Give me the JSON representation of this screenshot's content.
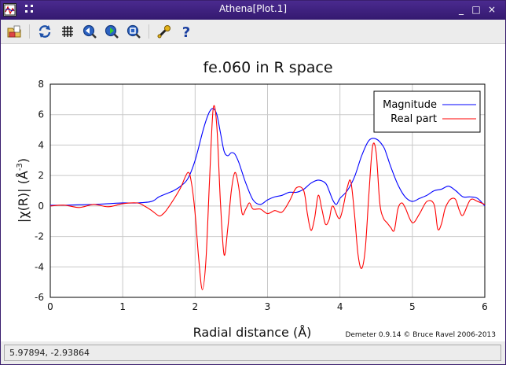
{
  "window": {
    "title": "Athena[Plot.1]",
    "buttons": [
      "_",
      "□",
      "×"
    ]
  },
  "toolbar": {
    "items": [
      {
        "icon": "open-folder-icon"
      },
      {
        "icon": "refresh-icon"
      },
      {
        "icon": "grid-icon"
      },
      {
        "icon": "zoom-back-icon"
      },
      {
        "icon": "zoom-forward-icon"
      },
      {
        "icon": "zoom-icon"
      },
      {
        "icon": "settings-wrench-icon"
      },
      {
        "icon": "help-icon"
      }
    ]
  },
  "status": {
    "text": "5.97894, -2.93864"
  },
  "colors": {
    "magnitude": "#0000ff",
    "real": "#ff0000",
    "titlebar": "#3d2080"
  },
  "chart_data": {
    "type": "line",
    "title": "fe.060 in R space",
    "xlabel": "Radial distance    (Å)",
    "ylabel": "|χ(R)|    (Å",
    "ylabel_sup": "-3",
    "ylabel_close": ")",
    "credit": "Demeter 0.9.14 © Bruce Ravel 2006-2013",
    "xlim": [
      0,
      6
    ],
    "ylim": [
      -6,
      8
    ],
    "xticks": [
      0,
      1,
      2,
      3,
      4,
      5,
      6
    ],
    "yticks": [
      -6,
      -4,
      -2,
      0,
      2,
      4,
      6,
      8
    ],
    "grid": true,
    "legend_position": "top-right",
    "series": [
      {
        "name": "Magnitude",
        "color": "#0000ff",
        "x": [
          0,
          0.2,
          0.4,
          0.6,
          0.8,
          1.0,
          1.2,
          1.4,
          1.5,
          1.6,
          1.7,
          1.8,
          1.9,
          2.0,
          2.1,
          2.15,
          2.2,
          2.25,
          2.3,
          2.35,
          2.4,
          2.45,
          2.5,
          2.55,
          2.6,
          2.65,
          2.7,
          2.8,
          2.9,
          3.0,
          3.1,
          3.2,
          3.3,
          3.4,
          3.5,
          3.6,
          3.7,
          3.8,
          3.85,
          3.9,
          3.95,
          4.0,
          4.1,
          4.2,
          4.3,
          4.4,
          4.5,
          4.6,
          4.65,
          4.7,
          4.8,
          4.9,
          5.0,
          5.1,
          5.2,
          5.3,
          5.4,
          5.5,
          5.6,
          5.7,
          5.8,
          5.9,
          6.0
        ],
        "values": [
          0.05,
          0.05,
          0.08,
          0.1,
          0.15,
          0.2,
          0.2,
          0.3,
          0.6,
          0.8,
          1.0,
          1.3,
          1.8,
          3.0,
          4.8,
          5.6,
          6.2,
          6.4,
          6.0,
          4.8,
          3.6,
          3.3,
          3.5,
          3.4,
          2.9,
          2.2,
          1.5,
          0.4,
          0.1,
          0.4,
          0.6,
          0.7,
          0.9,
          0.9,
          1.1,
          1.5,
          1.7,
          1.5,
          1.0,
          0.4,
          0.1,
          0.5,
          1.0,
          1.9,
          3.3,
          4.3,
          4.4,
          3.9,
          3.3,
          2.6,
          1.4,
          0.6,
          0.3,
          0.5,
          0.7,
          1.0,
          1.1,
          1.3,
          1.0,
          0.6,
          0.6,
          0.5,
          0.0
        ]
      },
      {
        "name": "Real part",
        "color": "#ff0000",
        "x": [
          0,
          0.2,
          0.4,
          0.6,
          0.8,
          1.0,
          1.2,
          1.3,
          1.4,
          1.5,
          1.55,
          1.6,
          1.7,
          1.8,
          1.9,
          1.95,
          2.0,
          2.05,
          2.1,
          2.15,
          2.2,
          2.25,
          2.3,
          2.35,
          2.4,
          2.45,
          2.5,
          2.55,
          2.6,
          2.65,
          2.7,
          2.75,
          2.8,
          2.9,
          3.0,
          3.1,
          3.2,
          3.3,
          3.4,
          3.5,
          3.55,
          3.6,
          3.65,
          3.7,
          3.75,
          3.8,
          3.85,
          3.9,
          4.0,
          4.1,
          4.15,
          4.2,
          4.25,
          4.3,
          4.35,
          4.4,
          4.45,
          4.5,
          4.55,
          4.6,
          4.65,
          4.7,
          4.75,
          4.8,
          4.85,
          4.9,
          5.0,
          5.1,
          5.2,
          5.3,
          5.35,
          5.4,
          5.45,
          5.5,
          5.55,
          5.6,
          5.65,
          5.7,
          5.8,
          5.9,
          6.0
        ],
        "values": [
          0.0,
          0.05,
          -0.1,
          0.1,
          -0.05,
          0.15,
          0.2,
          0.0,
          -0.3,
          -0.65,
          -0.55,
          -0.3,
          0.4,
          1.2,
          2.2,
          1.5,
          -0.5,
          -3.5,
          -5.5,
          -3.5,
          1.8,
          6.4,
          5.2,
          0.2,
          -3.2,
          -1.5,
          1.0,
          2.2,
          1.3,
          -0.5,
          -0.2,
          0.2,
          -0.2,
          -0.2,
          -0.5,
          -0.3,
          -0.4,
          0.3,
          1.2,
          1.0,
          -0.5,
          -1.6,
          -0.8,
          0.7,
          -0.2,
          -1.2,
          -0.9,
          0.0,
          -0.8,
          1.2,
          1.6,
          -0.5,
          -3.2,
          -4.1,
          -2.8,
          0.8,
          3.9,
          3.5,
          0.2,
          -0.8,
          -1.1,
          -1.4,
          -1.6,
          -0.2,
          0.2,
          -0.1,
          -1.1,
          -0.5,
          0.3,
          0.1,
          -1.5,
          -1.2,
          -0.2,
          0.3,
          0.5,
          0.4,
          -0.3,
          -0.6,
          0.4,
          0.3,
          0.1
        ]
      }
    ]
  }
}
